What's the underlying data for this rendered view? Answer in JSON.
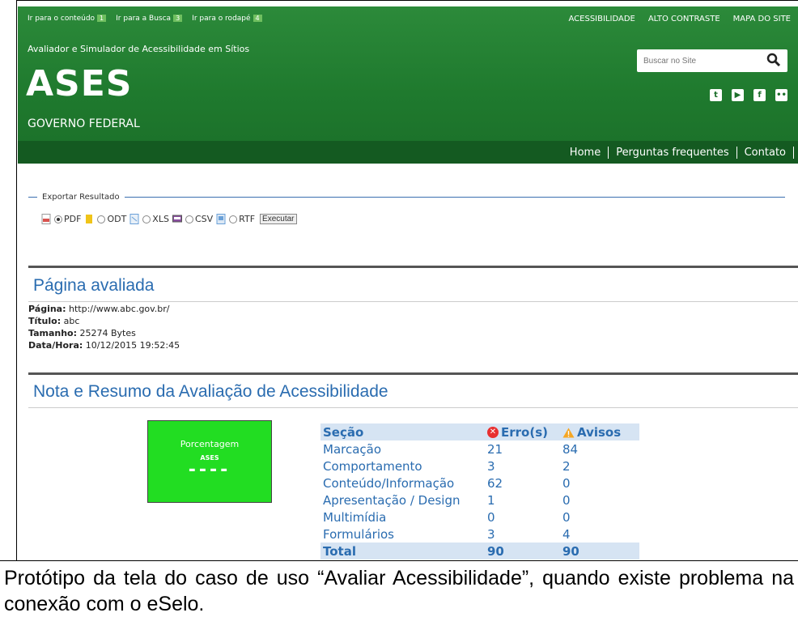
{
  "skip_links": [
    {
      "label": "Ir para o conteúdo",
      "key": "1"
    },
    {
      "label": "Ir para a Busca",
      "key": "3"
    },
    {
      "label": "Ir para o rodapé",
      "key": "4"
    }
  ],
  "top_links": [
    "ACESSIBILIDADE",
    "ALTO CONTRASTE",
    "MAPA DO SITE"
  ],
  "header": {
    "subtitle": "Avaliador e Simulador de Acessibilidade em Sítios",
    "logo": "ASES",
    "gov": "GOVERNO FEDERAL",
    "search_placeholder": "Buscar no Site",
    "social": [
      "twitter-icon",
      "youtube-icon",
      "facebook-icon",
      "flickr-icon"
    ]
  },
  "nav": [
    "Home",
    "Perguntas frequentes",
    "Contato"
  ],
  "export": {
    "legend": "Exportar Resultado",
    "formats": [
      {
        "label": "PDF",
        "selected": true,
        "icon": "pdf-file-icon",
        "color": "#d9534f"
      },
      {
        "label": "ODT",
        "selected": false,
        "icon": "odt-file-icon",
        "color": "#f0c419"
      },
      {
        "label": "XLS",
        "selected": false,
        "icon": "xls-file-icon",
        "color": "#6aa0d8"
      },
      {
        "label": "CSV",
        "selected": false,
        "icon": "csv-file-icon",
        "color": "#8a4fa0"
      },
      {
        "label": "RTF",
        "selected": false,
        "icon": "rtf-file-icon",
        "color": "#6aa0d8"
      }
    ],
    "execute_label": "Executar"
  },
  "evaluated": {
    "title": "Página avaliada",
    "page_label": "Página:",
    "page_value": "http://www.abc.gov.br/",
    "title_label": "Título:",
    "title_value": "abc",
    "size_label": "Tamanho:",
    "size_value": "25274 Bytes",
    "datetime_label": "Data/Hora:",
    "datetime_value": "10/12/2015 19:52:45"
  },
  "summary": {
    "title": "Nota e Resumo da Avaliação de Acessibilidade",
    "percent_box": {
      "line1": "Porcentagem",
      "line2": "ASES",
      "value": "----"
    },
    "headers": {
      "section": "Seção",
      "errors": "Erro(s)",
      "warnings": "Avisos"
    },
    "rows": [
      {
        "section": "Marcação",
        "errors": "21",
        "warnings": "84"
      },
      {
        "section": "Comportamento",
        "errors": "3",
        "warnings": "2"
      },
      {
        "section": "Conteúdo/Informação",
        "errors": "62",
        "warnings": "0"
      },
      {
        "section": "Apresentação / Design",
        "errors": "1",
        "warnings": "0"
      },
      {
        "section": "Multimídia",
        "errors": "0",
        "warnings": "0"
      },
      {
        "section": "Formulários",
        "errors": "3",
        "warnings": "4"
      }
    ],
    "total": {
      "section": "Total",
      "errors": "90",
      "warnings": "90"
    }
  },
  "caption": "Protótipo da tela do caso de uso “Avaliar Acessibilidade”, quando existe problema na conexão com o eSelo.",
  "colors": {
    "header_green": "#1f7a2e",
    "nav_green": "#145a21",
    "accent_blue": "#2a6cb0",
    "percent_green": "#22dd22"
  }
}
